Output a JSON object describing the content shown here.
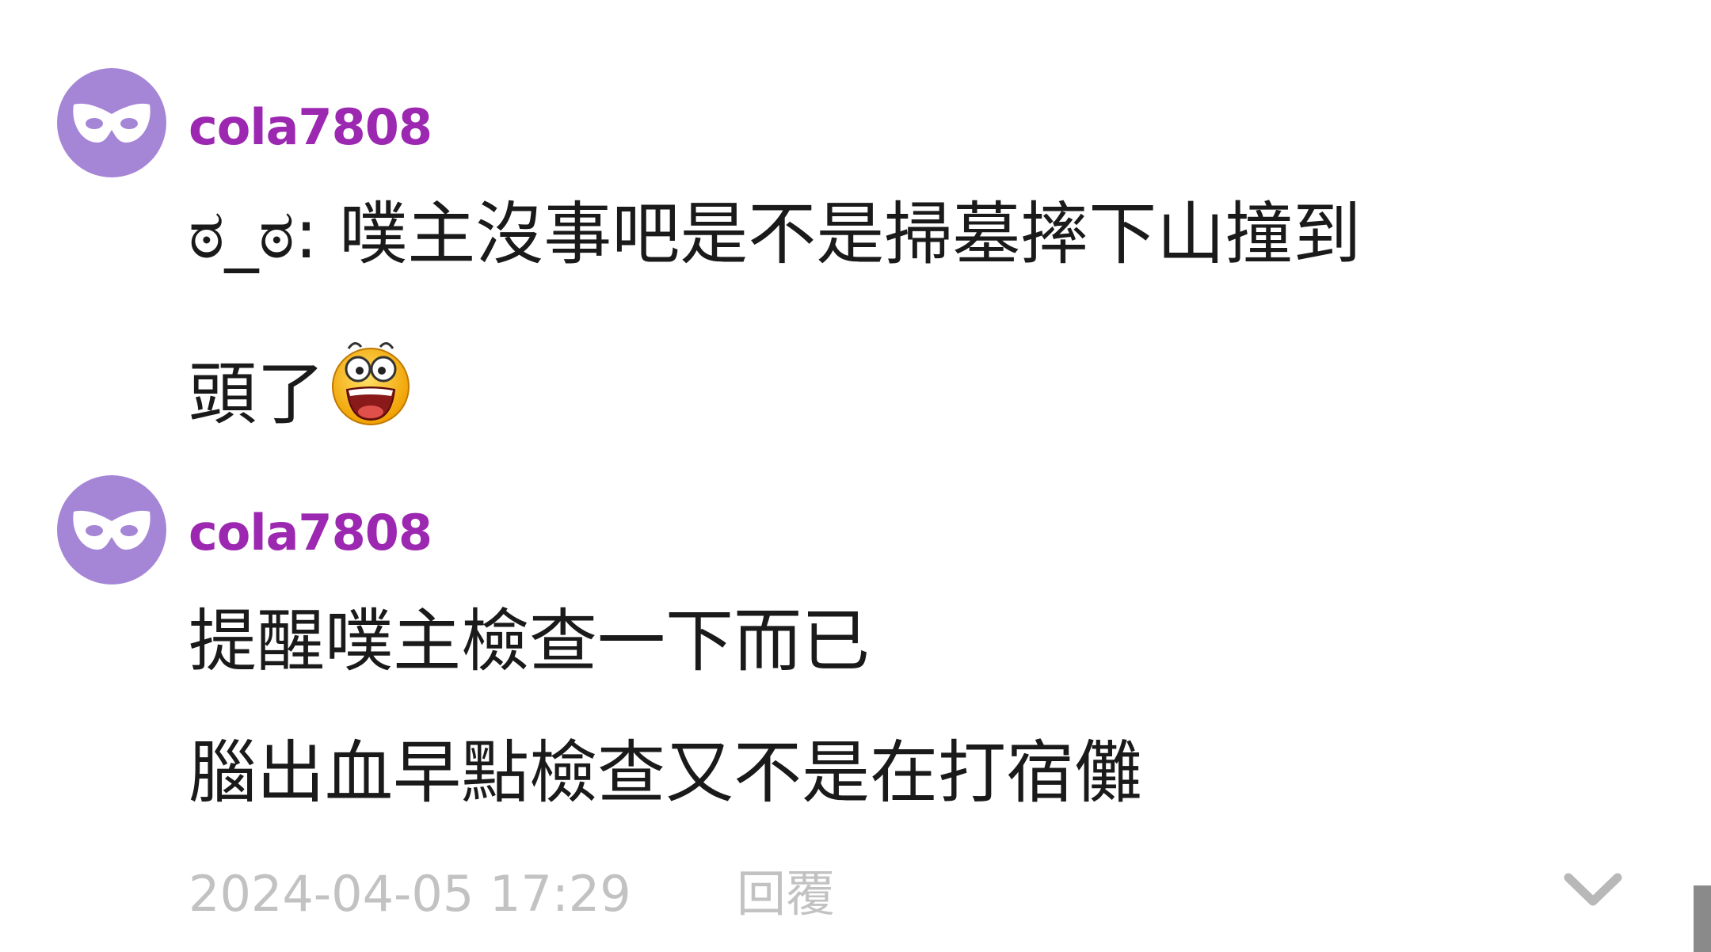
{
  "comments": [
    {
      "username": "cola7808",
      "lines": [
        "ಠ_ಠ: 噗主沒事吧是不是掃墓摔下山撞到",
        "頭了"
      ],
      "emoji_icon": "surprised-laughing-emoji-icon"
    },
    {
      "username": "cola7808",
      "lines": [
        "提醒噗主檢查一下而已",
        "腦出血早點檢查又不是在打宿儺"
      ]
    }
  ],
  "footer": {
    "timestamp": "2024-04-05 17:29",
    "reply_label": "回覆",
    "expand_icon": "chevron-down-icon"
  },
  "colors": {
    "avatar_bg": "#a585d6",
    "username": "#9c27b0",
    "text": "#1a1a1a",
    "muted": "#c2c2c2"
  }
}
